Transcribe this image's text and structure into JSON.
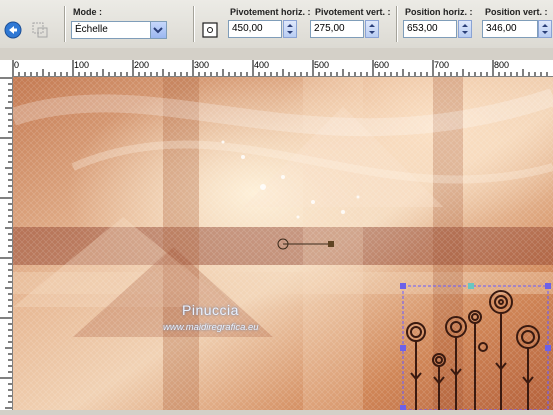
{
  "toolbar": {
    "mode_label": "Mode :",
    "mode_value": "Échelle",
    "pivot_h_label": "Pivotement horiz. :",
    "pivot_h_value": "450,00",
    "pivot_v_label": "Pivotement vert. :",
    "pivot_v_value": "275,00",
    "pos_h_label": "Position horiz. :",
    "pos_h_value": "653,00",
    "pos_v_label": "Position vert. :",
    "pos_v_value": "346,00"
  },
  "ruler": {
    "top_ticks": [
      "0",
      "100",
      "200",
      "300",
      "400",
      "500",
      "600",
      "700",
      "800"
    ]
  },
  "canvas": {
    "watermark_name": "Pinuccia",
    "watermark_url": "www.maidiregrafica.eu"
  },
  "colors": {
    "accent": "#6a5cff",
    "selection_handle": "#6c61e8",
    "pivot_handle": "#5f4424"
  }
}
